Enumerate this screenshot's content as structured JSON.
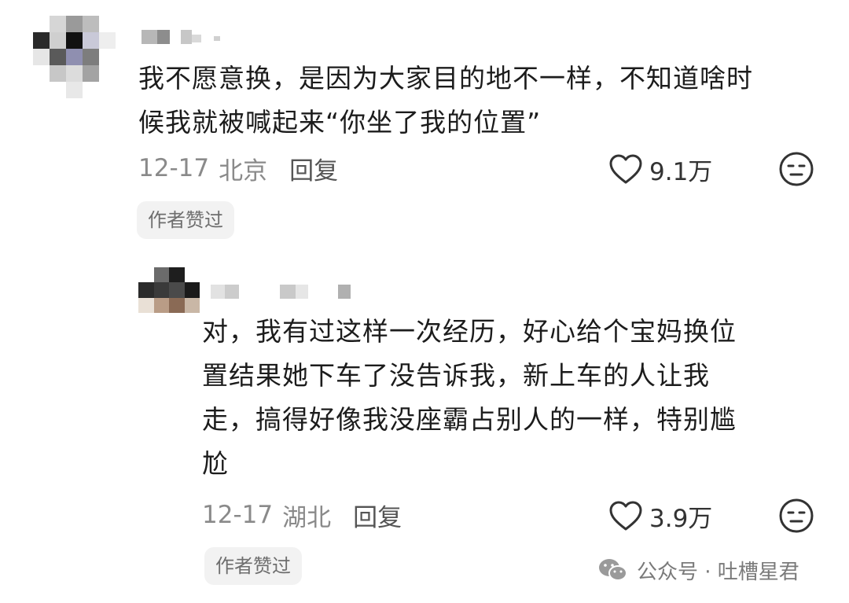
{
  "comments": [
    {
      "text": "我不愿意换，是因为大家目的地不一样，不知道啥时\n候我就被喊起来“你坐了我的位置”",
      "date": "12-17",
      "location": "北京",
      "reply_label": "回复",
      "likes": "9.1万",
      "badge": "作者赞过"
    },
    {
      "text": "对，我有过这样一次经历，好心给个宝妈换位\n置结果她下车了没告诉我，新上车的人让我\n走，搞得好像我没座霸占别人的一样，特别尴\n尬",
      "date": "12-17",
      "location": "湖北",
      "reply_label": "回复",
      "likes": "3.9万",
      "badge": "作者赞过"
    }
  ],
  "watermark": {
    "text": "公众号 · 吐槽星君",
    "icon": "wechat-icon"
  },
  "icons": {
    "like": "heart-outline-icon",
    "emoji": "neutral-face-icon"
  },
  "colors": {
    "text": "#1c1c1c",
    "meta": "#8a8a8a",
    "badge_bg": "#f2f2f2"
  }
}
